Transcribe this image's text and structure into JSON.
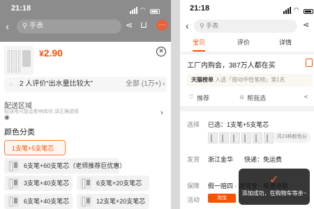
{
  "left_screen": {
    "status_time": "21:18",
    "search_placeholder": "手表",
    "more_badge": "···",
    "price_currency": "¥",
    "price_value": "2.90",
    "review_text": "2 人评价“出水量比较大”",
    "review_all": "全部 (1万+)",
    "address_title": "配送区域",
    "address_hint": "配送地可能会影响库存,请正确选择",
    "color_title": "颜色分类",
    "options": [
      {
        "label": "1支笔+5支笔芯",
        "selected": true
      },
      {
        "label": "6支笔+60支笔芯（老师推荐巨优惠）",
        "selected": false
      },
      {
        "label": "3支笔+40支笔芯",
        "selected": false
      },
      {
        "label": "6支笔+20支笔芯",
        "selected": false
      },
      {
        "label": "6支笔+40支笔芯",
        "selected": false
      },
      {
        "label": "12支笔+20支笔芯",
        "selected": false
      }
    ]
  },
  "right_screen": {
    "status_time": "21:18",
    "search_placeholder": "手表",
    "tabs": [
      "宝贝",
      "评价",
      "详情"
    ],
    "active_tab": "宝贝",
    "title": "工厂内购会，387万人都在买",
    "rank_strong": "天猫榜单",
    "rank_rest": "入选「按动中性笔榜」第1名",
    "action_recommend": "推荐",
    "action_help": "帮我选",
    "select_label": "选择",
    "select_value": "已选：1支笔+5支笔芯",
    "variants_count": "共23种颜色分",
    "ship_label": "发货",
    "ship_from": "浙江金华",
    "ship_method": "快递：免运费",
    "guarantee_label": "保障",
    "guarantee_value": "假一赔四 · 退货宝 · 极速退款",
    "activity_label": "活动",
    "activity_tag": "淘宝",
    "toast_text": "添加成功，在购物车等亲~"
  }
}
